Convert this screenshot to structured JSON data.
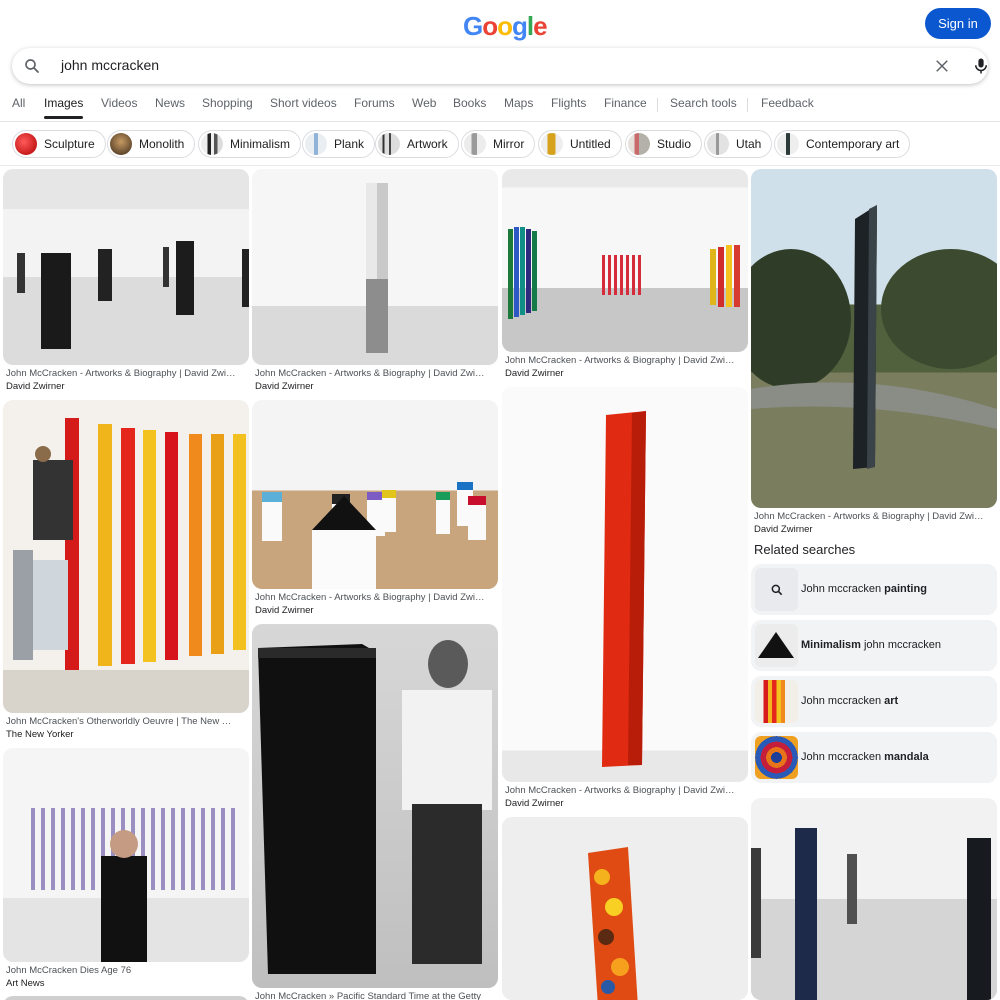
{
  "header": {
    "logo_letters": [
      "G",
      "o",
      "o",
      "g",
      "l",
      "e"
    ],
    "logo_colors": [
      "#4285F4",
      "#EA4335",
      "#FBBC05",
      "#4285F4",
      "#34A853",
      "#EA4335"
    ],
    "sign_in_label": "Sign in",
    "accent": "#0b57d0"
  },
  "search": {
    "query": "john mccracken",
    "search_icon": "search-icon",
    "clear_icon": "close-icon",
    "mic_icon": "mic-icon"
  },
  "tabs": [
    {
      "label": "All"
    },
    {
      "label": "Images",
      "active": true
    },
    {
      "label": "Videos"
    },
    {
      "label": "News"
    },
    {
      "label": "Shopping"
    },
    {
      "label": "Short videos"
    },
    {
      "label": "Forums"
    },
    {
      "label": "Web"
    },
    {
      "label": "Books"
    },
    {
      "label": "Maps"
    },
    {
      "label": "Flights"
    },
    {
      "label": "Finance"
    },
    {
      "label": "Search tools"
    },
    {
      "label": "Feedback"
    }
  ],
  "chips": [
    {
      "label": "Sculpture"
    },
    {
      "label": "Monolith"
    },
    {
      "label": "Minimalism"
    },
    {
      "label": "Plank"
    },
    {
      "label": "Artwork"
    },
    {
      "label": "Mirror"
    },
    {
      "label": "Untitled"
    },
    {
      "label": "Studio"
    },
    {
      "label": "Utah"
    },
    {
      "label": "Contemporary art"
    }
  ],
  "results": [
    {
      "title": "John McCracken - Artworks & Biography | David Zwirner",
      "source": "David Zwirner"
    },
    {
      "title": "John McCracken - Artworks & Biography | David Zwirner",
      "source": "David Zwirner"
    },
    {
      "title": "John McCracken - Artworks & Biography | David Zwirner",
      "source": "David Zwirner"
    },
    {
      "title": "John McCracken - Artworks & Biography | David Zwirner",
      "source": "David Zwirner"
    },
    {
      "title": "John McCracken's Otherworldly Oeuvre | The New Yorker",
      "source": "The New Yorker"
    },
    {
      "title": "John McCracken - Artworks & Biography | David Zwirner",
      "source": "David Zwirner"
    },
    {
      "title": "John McCracken - Artworks & Biography | David Zwirner",
      "source": "David Zwirner"
    },
    {
      "title": "John McCracken Dies Age 76",
      "source": "Art News"
    },
    {
      "title": "John McCracken » Pacific Standard Time at the Getty",
      "source": ""
    }
  ],
  "related": {
    "title": "Related searches",
    "items": [
      {
        "pre": "John mccracken ",
        "bold": "painting",
        "post": ""
      },
      {
        "pre": "",
        "bold": "Minimalism",
        "post": " john mccracken"
      },
      {
        "pre": "John mccracken ",
        "bold": "art",
        "post": ""
      },
      {
        "pre": "John mccracken ",
        "bold": "mandala",
        "post": ""
      }
    ]
  }
}
